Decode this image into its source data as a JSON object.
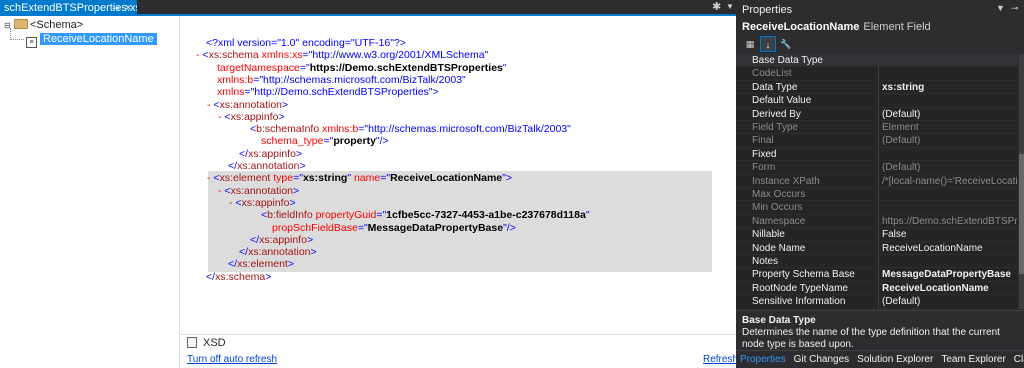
{
  "editor": {
    "tab_title": "schExtendBTSProperties.xsd",
    "pin_icon": "⊸",
    "close_icon": "×",
    "tree": {
      "schema_node": "<Schema>",
      "element_node": "ReceiveLocationName"
    },
    "xml_lines": [
      {
        "indent": 0,
        "parts": [
          [
            "m",
            "<?xml version=\"1.0\" encoding=\"UTF-16\"?>"
          ]
        ]
      },
      {
        "indent": 0,
        "dash": true,
        "parts": [
          [
            "m",
            "<"
          ],
          [
            "t",
            "xs:schema"
          ],
          [
            "a",
            " xmlns:xs"
          ],
          [
            "m",
            "=\""
          ],
          [
            "s",
            "http://www.w3.org/2001/XMLSchema"
          ],
          [
            "m",
            "\""
          ]
        ]
      },
      {
        "indent": 1,
        "parts": [
          [
            "a",
            "targetNamespace"
          ],
          [
            "m",
            "=\""
          ],
          [
            "b",
            "https://Demo.schExtendBTSProperties"
          ],
          [
            "m",
            "\""
          ]
        ]
      },
      {
        "indent": 1,
        "parts": [
          [
            "a",
            "xmlns:b"
          ],
          [
            "m",
            "=\""
          ],
          [
            "s",
            "http://schemas.microsoft.com/BizTalk/2003"
          ],
          [
            "m",
            "\""
          ]
        ]
      },
      {
        "indent": 1,
        "parts": [
          [
            "a",
            "xmlns"
          ],
          [
            "m",
            "=\""
          ],
          [
            "s",
            "http://Demo.schExtendBTSProperties"
          ],
          [
            "m",
            "\">"
          ]
        ]
      },
      {
        "indent": 1,
        "dash": true,
        "parts": [
          [
            "m",
            "<"
          ],
          [
            "t",
            "xs:annotation"
          ],
          [
            "m",
            ">"
          ]
        ]
      },
      {
        "indent": 2,
        "dash": true,
        "parts": [
          [
            "m",
            "<"
          ],
          [
            "t",
            "xs:appinfo"
          ],
          [
            "m",
            ">"
          ]
        ]
      },
      {
        "indent": 4,
        "parts": [
          [
            "m",
            "<"
          ],
          [
            "t",
            "b:schemaInfo"
          ],
          [
            "a",
            " xmlns:b"
          ],
          [
            "m",
            "=\""
          ],
          [
            "s",
            "http://schemas.microsoft.com/BizTalk/2003"
          ],
          [
            "m",
            "\""
          ]
        ]
      },
      {
        "indent": 5,
        "parts": [
          [
            "a",
            "schema_type"
          ],
          [
            "m",
            "=\""
          ],
          [
            "b",
            "property"
          ],
          [
            "m",
            "\"/>"
          ]
        ]
      },
      {
        "indent": 3,
        "parts": [
          [
            "m",
            "</"
          ],
          [
            "t",
            "xs:appinfo"
          ],
          [
            "m",
            ">"
          ]
        ]
      },
      {
        "indent": 2,
        "parts": [
          [
            "m",
            "</"
          ],
          [
            "t",
            "xs:annotation"
          ],
          [
            "m",
            ">"
          ]
        ]
      },
      {
        "indent": 1,
        "dash": true,
        "parts": [
          [
            "m",
            "<"
          ],
          [
            "t",
            "xs:element"
          ],
          [
            "a",
            " type"
          ],
          [
            "m",
            "=\""
          ],
          [
            "b",
            "xs:string"
          ],
          [
            "m",
            "\""
          ],
          [
            "a",
            " name"
          ],
          [
            "m",
            "=\""
          ],
          [
            "b",
            "ReceiveLocationName"
          ],
          [
            "m",
            "\">"
          ]
        ]
      },
      {
        "indent": 2,
        "dash": true,
        "parts": [
          [
            "m",
            "<"
          ],
          [
            "t",
            "xs:annotation"
          ],
          [
            "m",
            ">"
          ]
        ]
      },
      {
        "indent": 3,
        "dash": true,
        "parts": [
          [
            "m",
            "<"
          ],
          [
            "t",
            "xs:appinfo"
          ],
          [
            "m",
            ">"
          ]
        ]
      },
      {
        "indent": 5,
        "parts": [
          [
            "m",
            "<"
          ],
          [
            "t",
            "b:fieldInfo"
          ],
          [
            "a",
            " propertyGuid"
          ],
          [
            "m",
            "=\""
          ],
          [
            "b",
            "1cfbe5cc-7327-4453-a1be-c237678d118a"
          ],
          [
            "m",
            "\""
          ]
        ]
      },
      {
        "indent": 6,
        "parts": [
          [
            "a",
            "propSchFieldBase"
          ],
          [
            "m",
            "=\""
          ],
          [
            "b",
            "MessageDataPropertyBase"
          ],
          [
            "m",
            "\"/>"
          ]
        ]
      },
      {
        "indent": 4,
        "parts": [
          [
            "m",
            "</"
          ],
          [
            "t",
            "xs:appinfo"
          ],
          [
            "m",
            ">"
          ]
        ]
      },
      {
        "indent": 3,
        "parts": [
          [
            "m",
            "</"
          ],
          [
            "t",
            "xs:annotation"
          ],
          [
            "m",
            ">"
          ]
        ]
      },
      {
        "indent": 2,
        "parts": [
          [
            "m",
            "</"
          ],
          [
            "t",
            "xs:element"
          ],
          [
            "m",
            ">"
          ]
        ]
      },
      {
        "indent": 0,
        "parts": [
          [
            "m",
            "</"
          ],
          [
            "t",
            "xs:schema"
          ],
          [
            "m",
            ">"
          ]
        ]
      }
    ],
    "bottom_tab": "XSD",
    "turn_off_link": "Turn off auto refresh",
    "refresh_link": "Refresh"
  },
  "properties": {
    "title": "Properties",
    "object_name": "ReceiveLocationName",
    "object_kind": "Element Field",
    "rows": [
      {
        "key": "Base Data Type",
        "value": "",
        "style": "first"
      },
      {
        "key": "CodeList",
        "value": "",
        "style": "dim"
      },
      {
        "key": "Data Type",
        "value": "xs:string",
        "style": "value-bold"
      },
      {
        "key": "Default Value",
        "value": "",
        "style": "normal"
      },
      {
        "key": "Derived By",
        "value": "(Default)",
        "style": "normal"
      },
      {
        "key": "Field Type",
        "value": "Element",
        "style": "dim"
      },
      {
        "key": "Final",
        "value": "(Default)",
        "style": "dim"
      },
      {
        "key": "Fixed",
        "value": "",
        "style": "normal"
      },
      {
        "key": "Form",
        "value": "(Default)",
        "style": "dim"
      },
      {
        "key": "Instance XPath",
        "value": "/*[local-name()='ReceiveLocationNa",
        "style": "dim"
      },
      {
        "key": "Max Occurs",
        "value": "",
        "style": "dim"
      },
      {
        "key": "Min Occurs",
        "value": "",
        "style": "dim"
      },
      {
        "key": "Namespace",
        "value": "https://Demo.schExtendBTSPropertie",
        "style": "dim"
      },
      {
        "key": "Nillable",
        "value": "False",
        "style": "normal"
      },
      {
        "key": "Node Name",
        "value": "ReceiveLocationName",
        "style": "normal"
      },
      {
        "key": "Notes",
        "value": "",
        "style": "normal"
      },
      {
        "key": "Property Schema Base",
        "value": "MessageDataPropertyBase",
        "style": "value-bold"
      },
      {
        "key": "RootNode TypeName",
        "value": "ReceiveLocationName",
        "style": "value-bold"
      },
      {
        "key": "Sensitive Information",
        "value": "(Default)",
        "style": "normal"
      }
    ],
    "description": {
      "title": "Base Data Type",
      "text": "Determines the name of the type definition that the current node type is based upon."
    },
    "bottom_tabs": [
      "Properties",
      "Git Changes",
      "Solution Explorer",
      "Team Explorer",
      "Class View"
    ]
  }
}
